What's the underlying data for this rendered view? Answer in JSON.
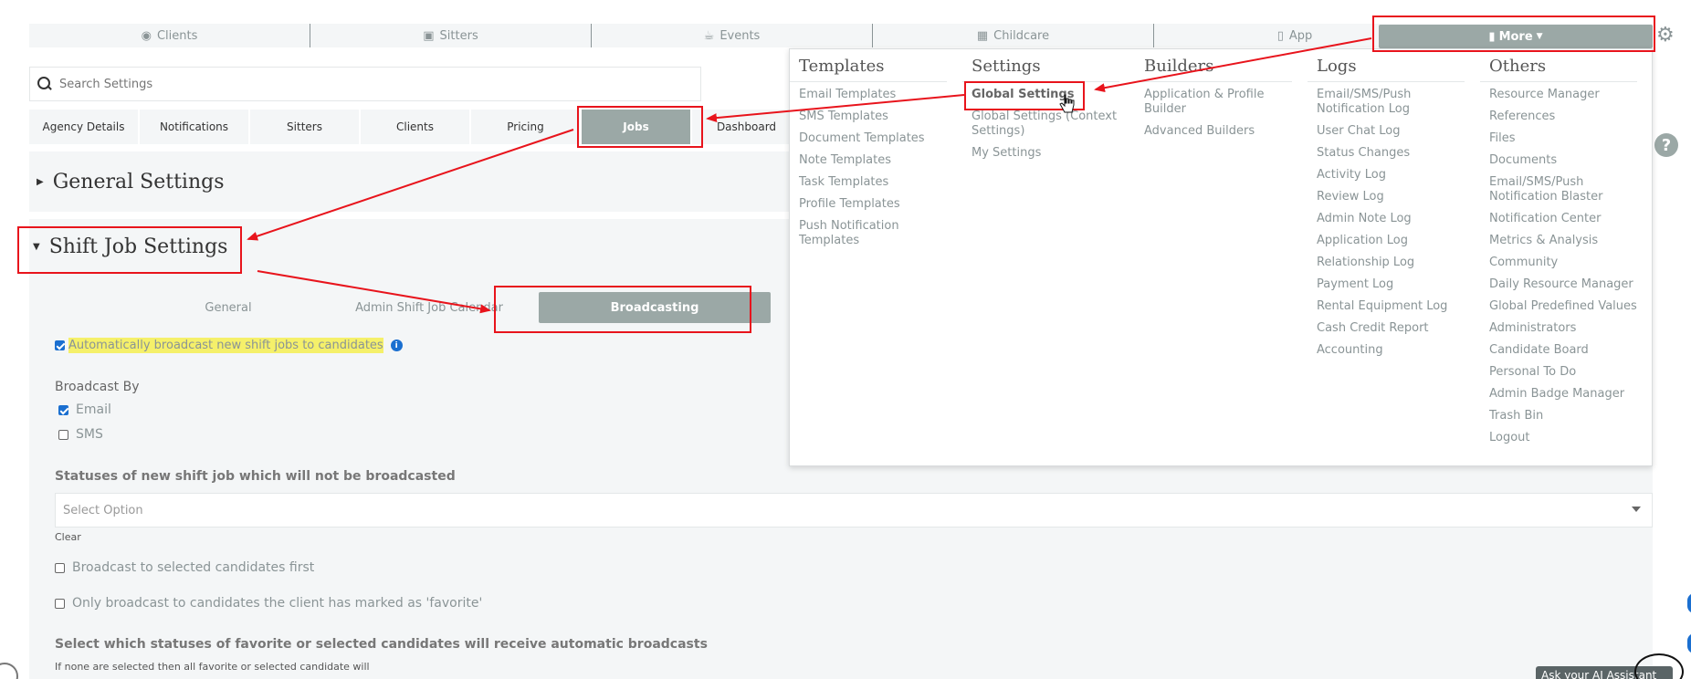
{
  "nav": {
    "items": [
      {
        "label": "Clients",
        "icon": "palette-icon"
      },
      {
        "label": "Sitters",
        "icon": "briefcase-icon"
      },
      {
        "label": "Events",
        "icon": "trophy-icon"
      },
      {
        "label": "Childcare",
        "icon": "calendar-icon"
      },
      {
        "label": "App",
        "icon": "mobile-icon"
      }
    ],
    "more_label": "More"
  },
  "search": {
    "placeholder": "Search Settings"
  },
  "tabs": [
    "Agency Details",
    "Notifications",
    "Sitters",
    "Clients",
    "Pricing",
    "Jobs",
    "Dashboard"
  ],
  "active_tab": "Jobs",
  "general_title": "General Settings",
  "shift": {
    "title": "Shift Job Settings",
    "subtabs": [
      "General",
      "Admin Shift Job Calendar",
      "Broadcasting"
    ],
    "auto_broadcast": {
      "label": "Automatically broadcast new shift jobs to candidates",
      "checked": true
    },
    "broadcast_by_label": "Broadcast By",
    "broadcast_by": [
      {
        "label": "Email",
        "checked": true
      },
      {
        "label": "SMS",
        "checked": false
      }
    ],
    "statuses_label": "Statuses of new shift job which will not be broadcasted",
    "select_placeholder": "Select Option",
    "clear_label": "Clear",
    "selected_first_label": "Broadcast to selected candidates first",
    "favorite_only_label": "Only broadcast to candidates the client has marked as 'favorite'",
    "statuses_fav_label": "Select which statuses of favorite or selected candidates will receive automatic broadcasts",
    "statuses_fav_note": "If none are selected then all favorite or selected candidate will"
  },
  "menu": {
    "templates": {
      "title": "Templates",
      "items": [
        "Email Templates",
        "SMS Templates",
        "Document Templates",
        "Note Templates",
        "Task Templates",
        "Profile Templates",
        "Push Notification Templates"
      ]
    },
    "settings": {
      "title": "Settings",
      "items": [
        "Global Settings",
        "Global Settings (Context Settings)",
        "My Settings"
      ]
    },
    "builders": {
      "title": "Builders",
      "items": [
        "Application & Profile Builder",
        "Advanced Builders"
      ]
    },
    "logs": {
      "title": "Logs",
      "items": [
        "Email/SMS/Push Notification Log",
        "User Chat Log",
        "Status Changes",
        "Activity Log",
        "Review Log",
        "Admin Note Log",
        "Application Log",
        "Relationship Log",
        "Payment Log",
        "Rental Equipment Log",
        "Cash Credit Report",
        "Accounting"
      ]
    },
    "others": {
      "title": "Others",
      "items": [
        "Resource Manager",
        "References",
        "Files",
        "Documents",
        "Email/SMS/Push Notification Blaster",
        "Notification Center",
        "Metrics & Analysis",
        "Community",
        "Daily Resource Manager",
        "Global Predefined Values",
        "Administrators",
        "Candidate Board",
        "Personal To Do",
        "Admin Badge Manager",
        "Trash Bin",
        "Logout"
      ]
    }
  },
  "ask_ai_label": "Ask your AI Assistant",
  "colors": {
    "accent": "#9ba8a6",
    "annotation": "#e8141c",
    "highlight": "#f5f06a",
    "info": "#1a6fd0"
  }
}
